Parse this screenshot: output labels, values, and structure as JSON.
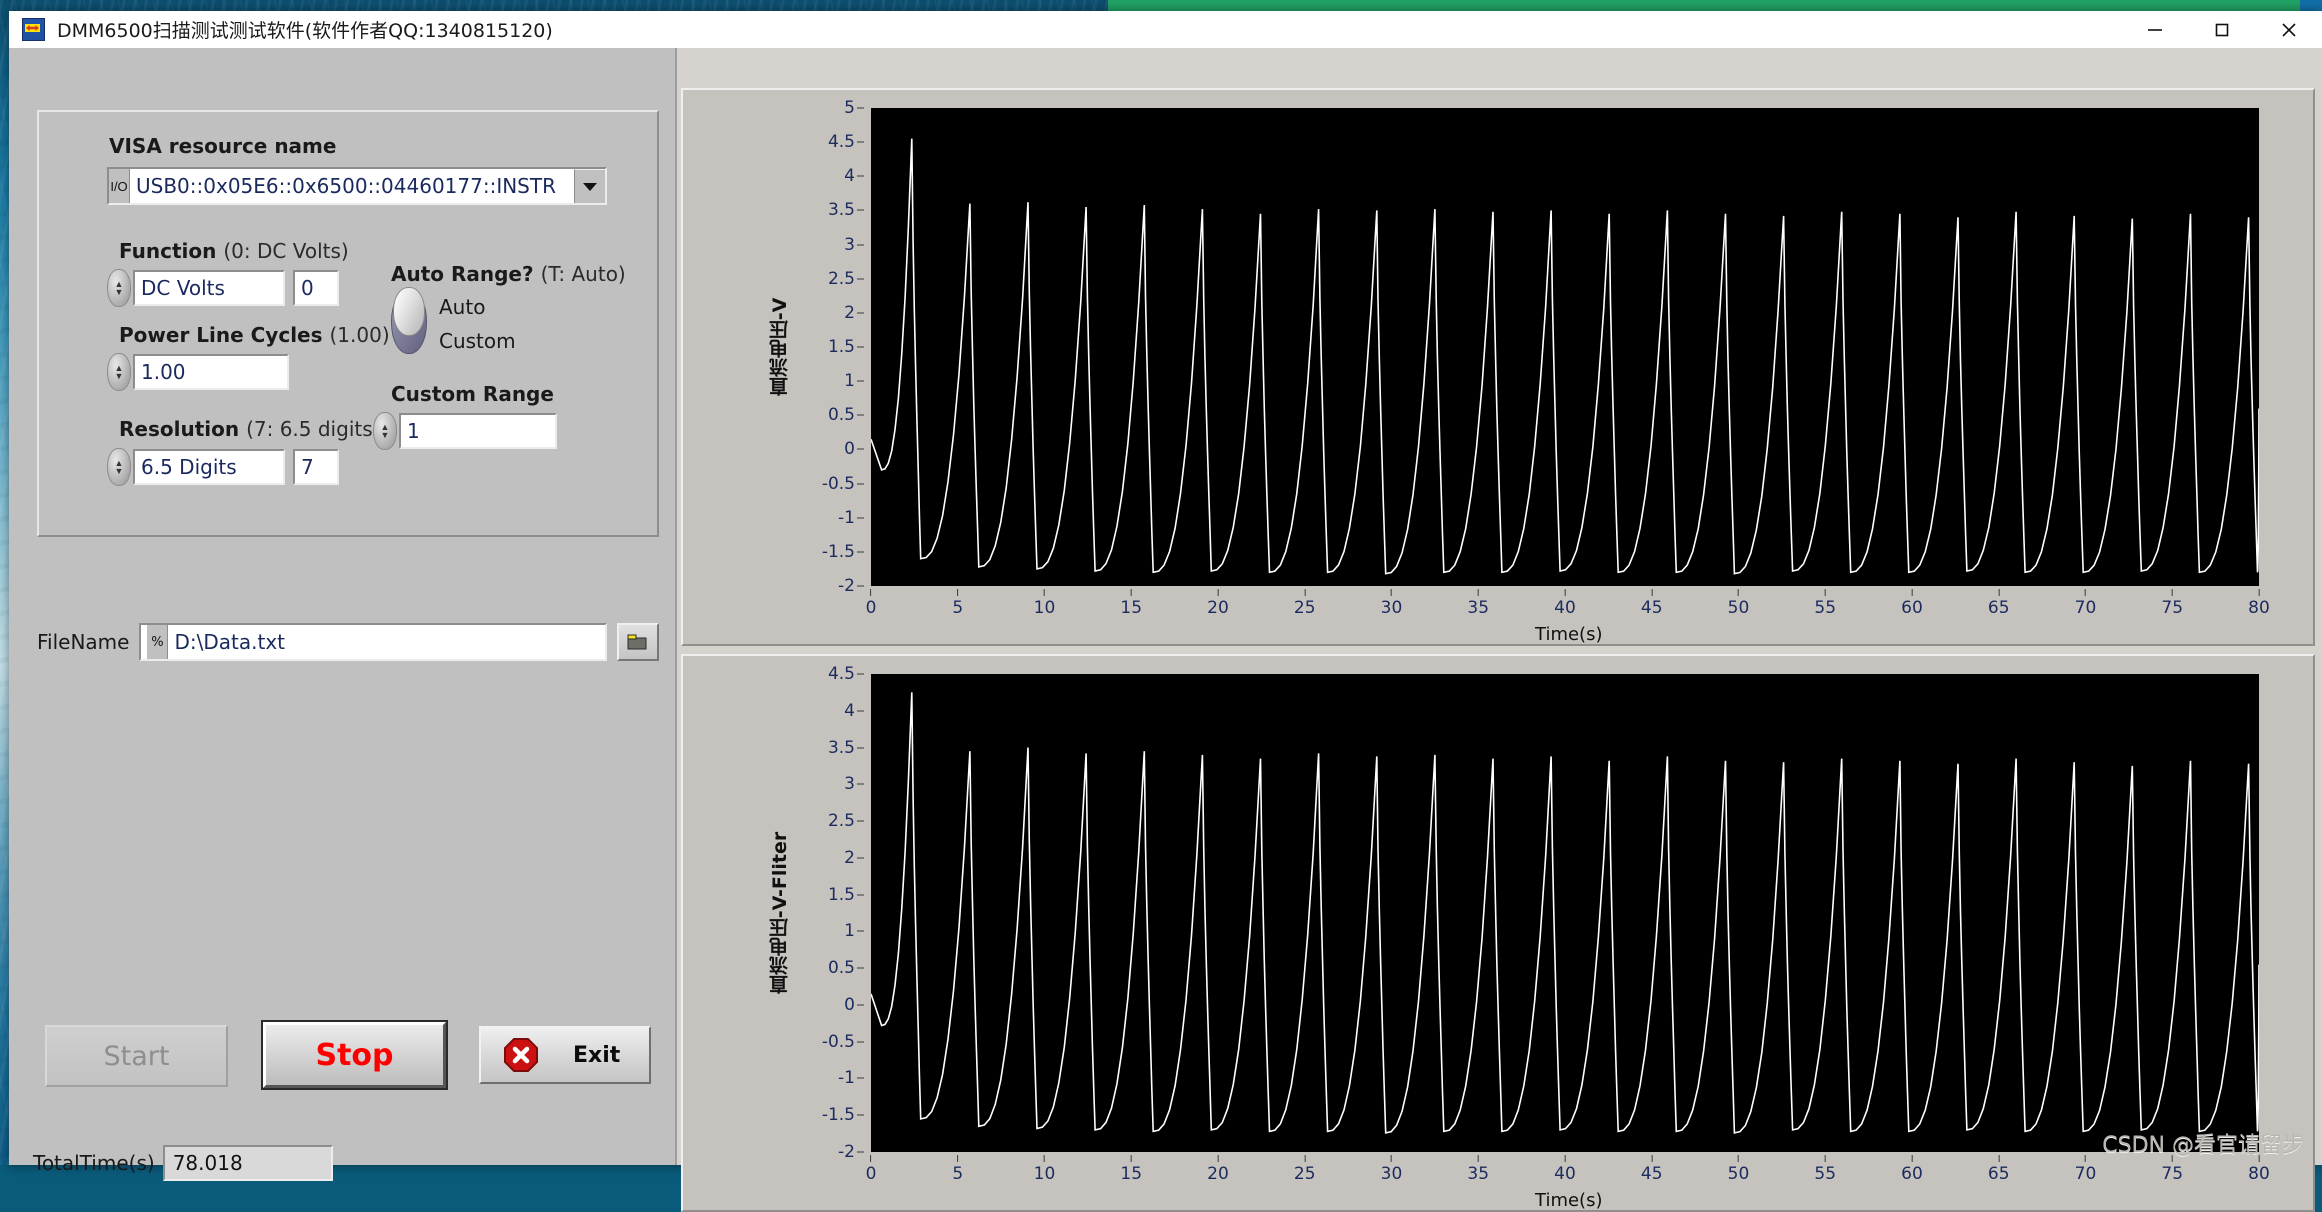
{
  "window": {
    "title": "DMM6500扫描测试测试软件(软件作者QQ:1340815120)",
    "icon": "labview-vi-icon",
    "controls": {
      "minimize": "minimize-icon",
      "maximize": "maximize-icon",
      "close": "close-icon"
    }
  },
  "panel": {
    "visa": {
      "label": "VISA resource name",
      "value": "USB0::0x05E6::0x6500::04460177::INSTR",
      "prefix_glyph": "I/O",
      "dropdown_glyph": "▼"
    },
    "function": {
      "label": "Function",
      "hint": "(0: DC Volts)",
      "value": "DC Volts",
      "numeric": "0"
    },
    "power_line_cycles": {
      "label": "Power Line Cycles",
      "hint": "(1.00)",
      "value": "1.00"
    },
    "resolution": {
      "label": "Resolution",
      "hint": "(7: 6.5 digits)",
      "value": "6.5 Digits",
      "numeric": "7"
    },
    "auto_range": {
      "label": "Auto Range?",
      "hint": "(T: Auto)",
      "option_top": "Auto",
      "option_bottom": "Custom",
      "selected": "Auto"
    },
    "custom_range": {
      "label": "Custom Range",
      "value": "1"
    },
    "filename": {
      "label": "FileName",
      "value": "D:\\Data.txt",
      "prefix_glyph": "%",
      "browse_icon": "folder-icon"
    },
    "buttons": {
      "start": "Start",
      "stop": "Stop",
      "exit": "Exit",
      "exit_icon": "stop-x-icon",
      "start_enabled": false
    },
    "total_time": {
      "label": "TotalTime(s)",
      "value": "78.018"
    }
  },
  "watermark": "CSDN @看官请留步",
  "chart_data": [
    {
      "type": "line",
      "name": "raw",
      "title": "",
      "ylabel": "直流电压-V",
      "xlabel": "Time(s)",
      "xlim": [
        0,
        80
      ],
      "ylim": [
        -2,
        5
      ],
      "xticks": [
        0,
        5,
        10,
        15,
        20,
        25,
        30,
        35,
        40,
        45,
        50,
        55,
        60,
        65,
        70,
        75,
        80
      ],
      "yticks": [
        -2,
        -1.5,
        -1,
        -0.5,
        0,
        0.5,
        1,
        1.5,
        2,
        2.5,
        3,
        3.5,
        4,
        4.5,
        5
      ],
      "grid": false,
      "legend": "none",
      "trace_color": "#ffffff",
      "background": "#000000",
      "waveform": {
        "shape": "sawtooth-spike",
        "period": 3.35,
        "first_peak_x": 2.35,
        "peak_values": [
          4.55,
          3.6,
          3.62,
          3.55,
          3.58,
          3.52,
          3.45,
          3.52,
          3.5,
          3.52,
          3.48,
          3.5,
          3.45,
          3.5,
          3.45,
          3.42,
          3.48,
          3.45,
          3.4,
          3.48,
          3.42,
          3.38,
          3.45,
          3.4
        ],
        "trough_values": [
          -0.3,
          -1.6,
          -1.72,
          -1.75,
          -1.78,
          -1.8,
          -1.78,
          -1.8,
          -1.8,
          -1.82,
          -1.8,
          -1.8,
          -1.78,
          -1.8,
          -1.8,
          -1.82,
          -1.78,
          -1.8,
          -1.8,
          -1.78,
          -1.8,
          -1.8,
          -1.78,
          -1.8
        ],
        "rise_fraction": 0.72,
        "end_value": 0.6
      }
    },
    {
      "type": "line",
      "name": "filtered",
      "title": "",
      "ylabel": "直流电压-V-Fliter",
      "xlabel": "Time(s)",
      "xlim": [
        0,
        80
      ],
      "ylim": [
        -2,
        4.5
      ],
      "xticks": [
        0,
        5,
        10,
        15,
        20,
        25,
        30,
        35,
        40,
        45,
        50,
        55,
        60,
        65,
        70,
        75,
        80
      ],
      "yticks": [
        -2,
        -1.5,
        -1,
        -0.5,
        0,
        0.5,
        1,
        1.5,
        2,
        2.5,
        3,
        3.5,
        4,
        4.5
      ],
      "grid": false,
      "legend": "none",
      "trace_color": "#ffffff",
      "background": "#000000",
      "waveform": {
        "shape": "sawtooth-spike",
        "period": 3.35,
        "first_peak_x": 2.35,
        "peak_values": [
          4.25,
          3.45,
          3.5,
          3.42,
          3.45,
          3.4,
          3.35,
          3.42,
          3.38,
          3.4,
          3.35,
          3.38,
          3.32,
          3.38,
          3.32,
          3.3,
          3.35,
          3.32,
          3.28,
          3.35,
          3.3,
          3.25,
          3.32,
          3.28
        ],
        "trough_values": [
          -0.28,
          -1.55,
          -1.65,
          -1.68,
          -1.7,
          -1.72,
          -1.7,
          -1.72,
          -1.72,
          -1.74,
          -1.72,
          -1.72,
          -1.7,
          -1.72,
          -1.72,
          -1.74,
          -1.7,
          -1.72,
          -1.72,
          -1.7,
          -1.72,
          -1.72,
          -1.7,
          -1.72
        ],
        "rise_fraction": 0.72,
        "end_value": 0.55
      }
    }
  ]
}
